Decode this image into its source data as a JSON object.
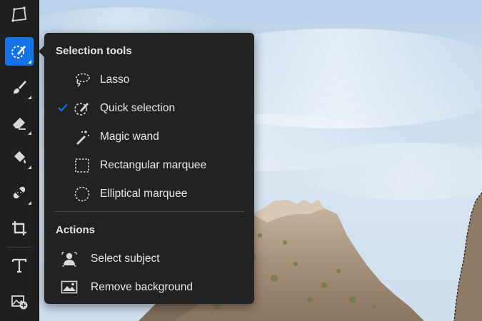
{
  "accent_color": "#1473e6",
  "toolbar": {
    "tools": [
      {
        "name": "pen-tool",
        "icon": "pen-path-icon"
      },
      {
        "name": "selection-tool",
        "icon": "quick-selection-icon",
        "active": true
      },
      {
        "name": "brush-tool",
        "icon": "brush-icon"
      },
      {
        "name": "eraser-tool",
        "icon": "eraser-icon"
      },
      {
        "name": "fill-tool",
        "icon": "paint-bucket-icon"
      },
      {
        "name": "healing-tool",
        "icon": "bandage-icon"
      },
      {
        "name": "crop-tool",
        "icon": "crop-icon"
      },
      {
        "name": "type-tool",
        "icon": "type-icon"
      },
      {
        "name": "add-image-tool",
        "icon": "add-image-icon"
      }
    ]
  },
  "menu": {
    "selection_title": "Selection tools",
    "selection_items": [
      {
        "label": "Lasso",
        "icon": "lasso-icon",
        "checked": false
      },
      {
        "label": "Quick selection",
        "icon": "quick-selection-icon",
        "checked": true
      },
      {
        "label": "Magic wand",
        "icon": "magic-wand-icon",
        "checked": false
      },
      {
        "label": "Rectangular marquee",
        "icon": "rectangular-marquee-icon",
        "checked": false
      },
      {
        "label": "Elliptical marquee",
        "icon": "elliptical-marquee-icon",
        "checked": false
      }
    ],
    "actions_title": "Actions",
    "action_items": [
      {
        "label": "Select subject",
        "icon": "select-subject-icon"
      },
      {
        "label": "Remove background",
        "icon": "remove-background-icon"
      }
    ]
  }
}
